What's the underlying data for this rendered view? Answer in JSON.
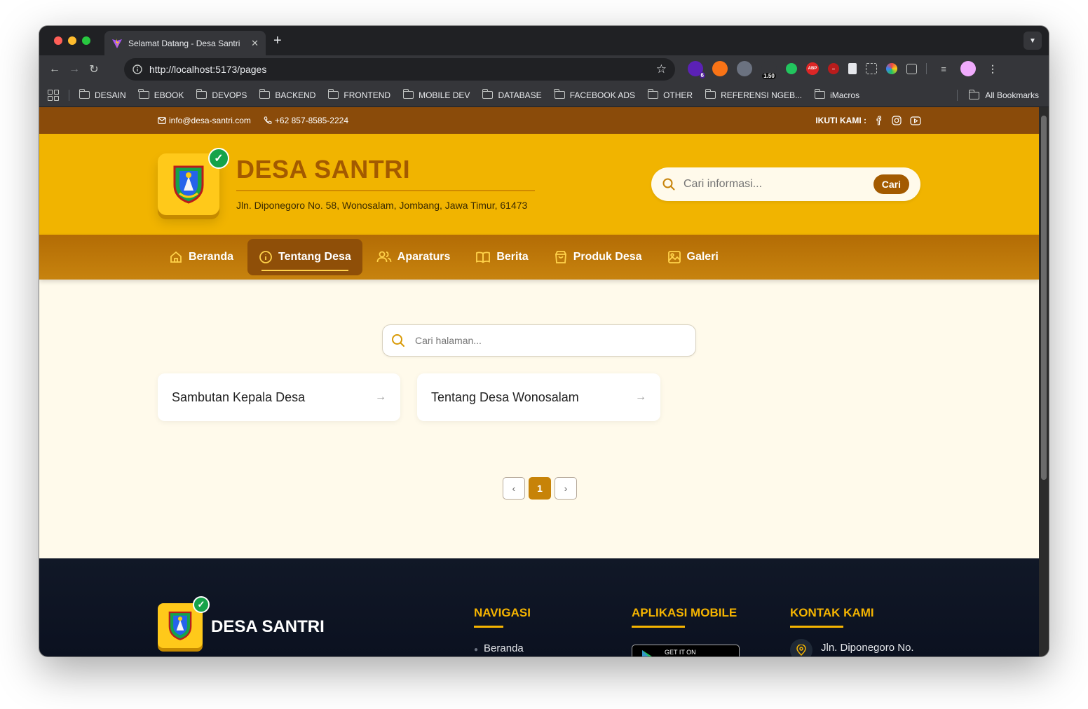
{
  "browser": {
    "tab_title": "Selamat Datang - Desa Santri",
    "url": "http://localhost:5173/pages",
    "extension_badges": [
      "6",
      "1.50",
      "ABP"
    ],
    "bookmarks": [
      "DESAIN",
      "EBOOK",
      "DEVOPS",
      "BACKEND",
      "FRONTEND",
      "MOBILE DEV",
      "DATABASE",
      "FACEBOOK ADS",
      "OTHER",
      "REFERENSI NGEB...",
      "iMacros"
    ],
    "all_bookmarks": "All Bookmarks"
  },
  "topbar": {
    "email": "info@desa-santri.com",
    "phone": "+62 857-8585-2224",
    "follow": "IKUTI KAMI :"
  },
  "header": {
    "title": "DESA SANTRI",
    "address": "Jln. Diponegoro No. 58, Wonosalam, Jombang, Jawa Timur, 61473",
    "search_placeholder": "Cari informasi...",
    "search_button": "Cari"
  },
  "nav": {
    "items": [
      {
        "label": "Beranda",
        "icon": "home-icon"
      },
      {
        "label": "Tentang Desa",
        "icon": "info-icon",
        "active": true
      },
      {
        "label": "Aparaturs",
        "icon": "users-icon"
      },
      {
        "label": "Berita",
        "icon": "book-icon"
      },
      {
        "label": "Produk Desa",
        "icon": "shopping-bag-icon"
      },
      {
        "label": "Galeri",
        "icon": "image-icon"
      }
    ]
  },
  "main": {
    "search_placeholder": "Cari halaman...",
    "pages": [
      "Sambutan Kepala Desa",
      "Tentang Desa Wonosalam"
    ],
    "pagination": {
      "current": "1"
    }
  },
  "footer": {
    "brand": "DESA SANTRI",
    "nav_title": "NAVIGASI",
    "nav_first": "Beranda",
    "app_title": "APLIKASI MOBILE",
    "gplay_text": "GET IT ON",
    "contact_title": "KONTAK KAMI",
    "contact_address": "Jln. Diponegoro No."
  },
  "colors": {
    "accent": "#f1b400",
    "brand_brown": "#a35a00",
    "topbar": "#8a4b0a",
    "footer": "#111827"
  }
}
